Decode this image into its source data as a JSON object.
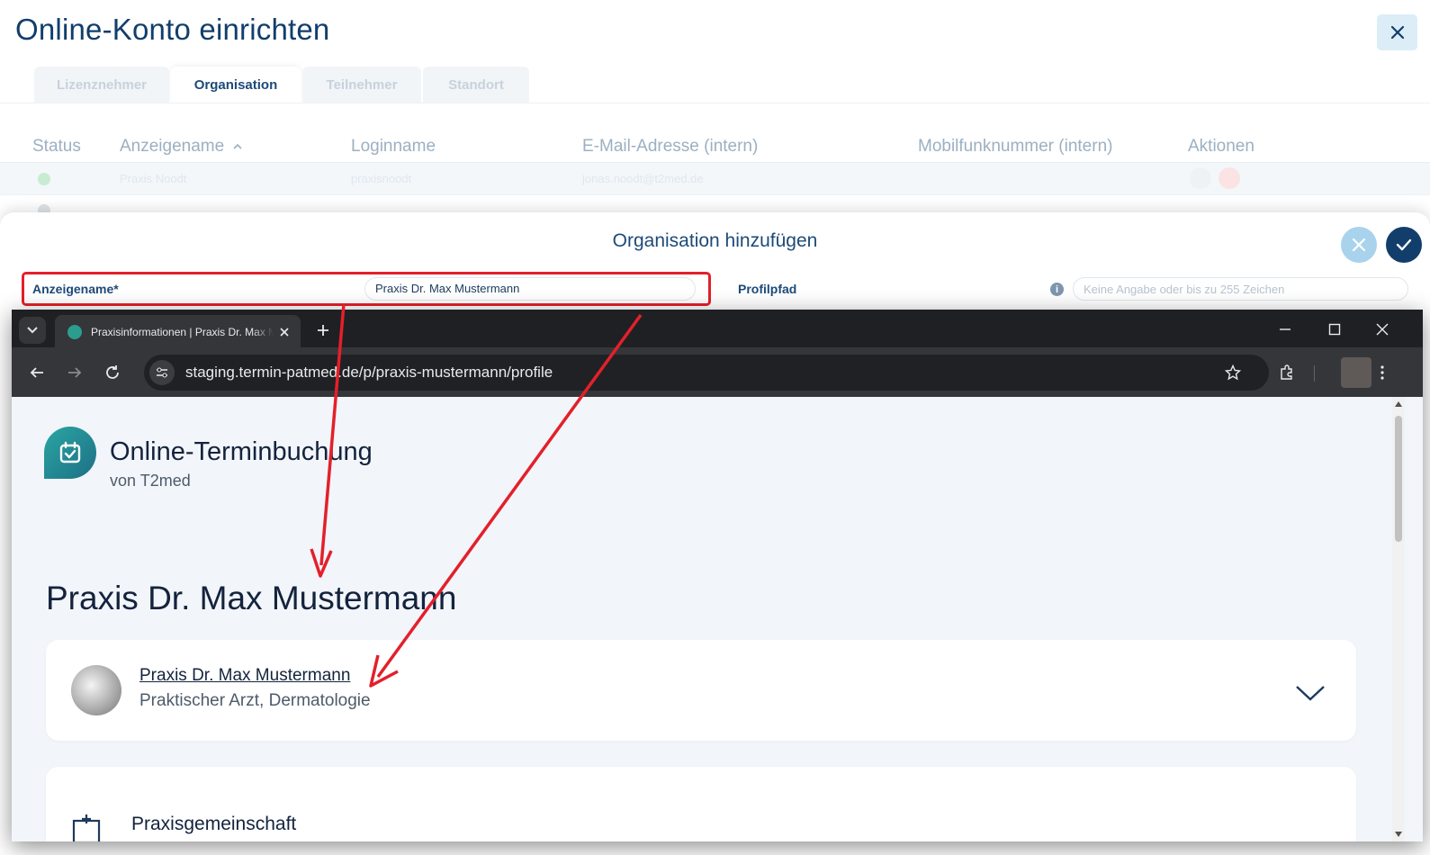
{
  "app": {
    "title": "Online-Konto einrichten",
    "close_icon": "close-icon",
    "tabs": [
      {
        "label": "Lizenznehmer",
        "active": false
      },
      {
        "label": "Organisation",
        "active": true
      },
      {
        "label": "Teilnehmer",
        "active": false
      },
      {
        "label": "Standort",
        "active": false
      }
    ],
    "table": {
      "headers": {
        "status": "Status",
        "display_name": "Anzeigename",
        "login": "Loginname",
        "email": "E-Mail-Adresse (intern)",
        "mobile": "Mobilfunknummer (intern)",
        "actions": "Aktionen"
      },
      "rows": [
        {
          "name": "Praxis Noodt",
          "login": "praxisnoodt",
          "email": "jonas.noodt@t2med.de"
        }
      ]
    }
  },
  "dialog": {
    "title": "Organisation hinzufügen",
    "display_name_label": "Anzeigename*",
    "display_name_value": "Praxis Dr. Max Mustermann",
    "profile_path_label": "Profilpfad",
    "profile_path_placeholder": "Keine Angabe oder bis zu 255 Zeichen",
    "info_glyph": "i"
  },
  "browser": {
    "tab_title": "Praxisinformationen | Praxis Dr. Max Mustermann",
    "url": "staging.termin-patmed.de/p/praxis-mustermann/profile",
    "page": {
      "brand_title": "Online-Terminbuchung",
      "brand_subtitle": "von T2med",
      "heading": "Praxis Dr. Max Mustermann",
      "card_name": "Praxis Dr. Max Mustermann",
      "card_specialty": "Praktischer Arzt, Dermatologie",
      "section_title": "Praxisgemeinschaft"
    }
  },
  "colors": {
    "primary": "#123e6b",
    "accent_light": "#a9d3ec",
    "highlight_red": "#e3202a",
    "browser_dark": "#35363a"
  }
}
